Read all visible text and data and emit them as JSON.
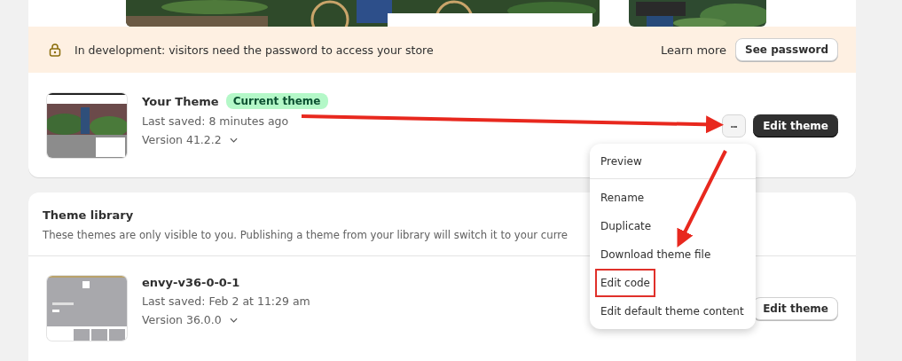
{
  "banner": {
    "message": "In development: visitors need the password to access your store",
    "link": "Learn more",
    "button": "See password"
  },
  "current_theme": {
    "name": "Your Theme",
    "badge": "Current theme",
    "last_saved": "Last saved: 8 minutes ago",
    "version": "Version 41.2.2",
    "more_button": "•••",
    "edit_button": "Edit theme"
  },
  "menu": {
    "items": [
      {
        "label": "Preview",
        "highlighted": false,
        "divider_after": true
      },
      {
        "label": "Rename",
        "highlighted": false,
        "divider_after": false
      },
      {
        "label": "Duplicate",
        "highlighted": false,
        "divider_after": false
      },
      {
        "label": "Download theme file",
        "highlighted": false,
        "divider_after": false
      },
      {
        "label": "Edit code",
        "highlighted": true,
        "divider_after": false
      },
      {
        "label": "Edit default theme content",
        "highlighted": false,
        "divider_after": false
      }
    ]
  },
  "library": {
    "title": "Theme library",
    "description": "These themes are only visible to you. Publishing a theme from your library will switch it to your curre",
    "themes": [
      {
        "name": "envy-v36-0-0-1",
        "last_saved": "Last saved: Feb 2 at 11:29 am",
        "version": "Version 36.0.0",
        "edit_button": "Edit theme"
      }
    ]
  }
}
